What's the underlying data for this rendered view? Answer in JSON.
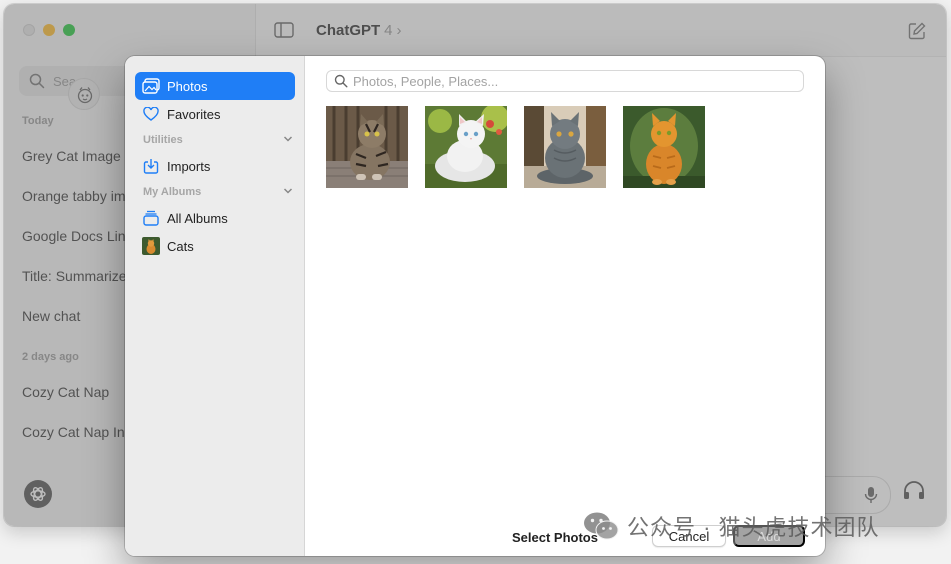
{
  "app": {
    "title": "ChatGPT",
    "model": "4",
    "search_placeholder": "Sea",
    "sections": {
      "today": "Today",
      "two_days_ago": "2 days ago"
    },
    "chats_today": [
      "Grey Cat Image",
      "Orange tabby im",
      "Google Docs Lin",
      "Title: Summarize",
      "New chat"
    ],
    "chats_older": [
      "Cozy Cat Nap",
      "Cozy Cat Nap In"
    ]
  },
  "dialog": {
    "sidebar": {
      "photos": "Photos",
      "favorites": "Favorites",
      "utilities": "Utilities",
      "imports": "Imports",
      "my_albums": "My Albums",
      "all_albums": "All Albums",
      "cats": "Cats"
    },
    "search_placeholder": "Photos, People, Places...",
    "footer": {
      "title": "Select Photos",
      "cancel": "Cancel",
      "add": "Add"
    }
  },
  "watermark": {
    "text": "公众号 · 猫头虎技术团队"
  },
  "colors": {
    "accent": "#1f7ef6",
    "sidebar": "#ececec"
  }
}
